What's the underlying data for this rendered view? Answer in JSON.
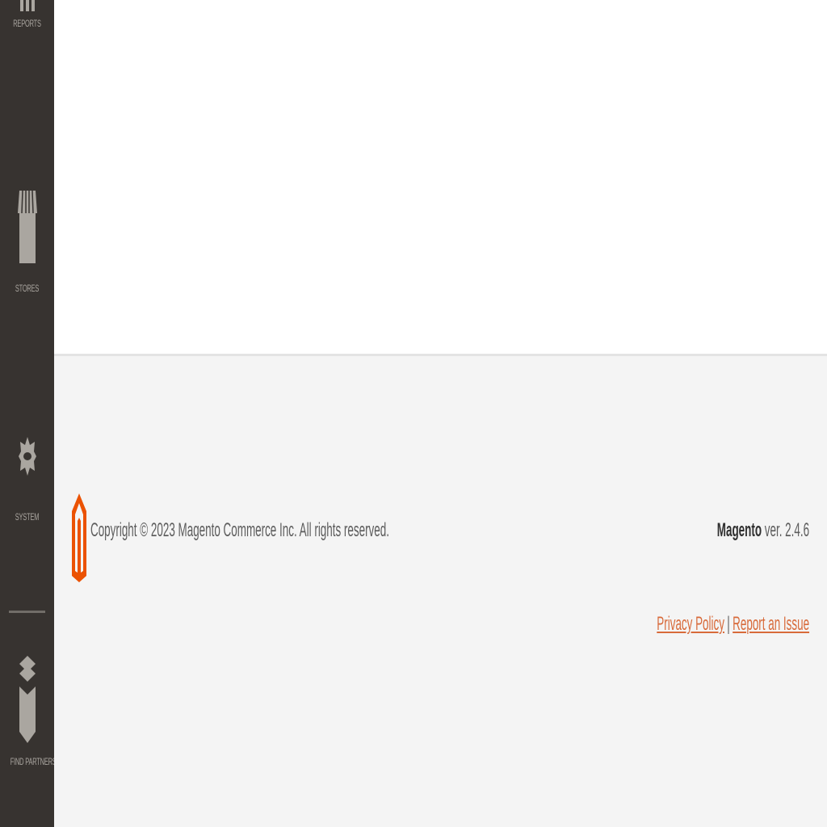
{
  "sidebar": {
    "items": [
      {
        "label": "REPORTS",
        "icon": "reports-icon"
      },
      {
        "label": "STORES",
        "icon": "stores-icon"
      },
      {
        "label": "SYSTEM",
        "icon": "gear-icon"
      },
      {
        "label": "FIND PARTNERS & EXTENSIONS",
        "icon": "partners-icon"
      }
    ]
  },
  "footer": {
    "copyright": "Copyright © 2023 Magento Commerce Inc. All rights reserved.",
    "brand": "Magento",
    "version": " ver. 2.4.6",
    "privacy_label": "Privacy Policy",
    "separator": "|",
    "report_label": "Report an Issue",
    "accent_color": "#eb5202"
  }
}
